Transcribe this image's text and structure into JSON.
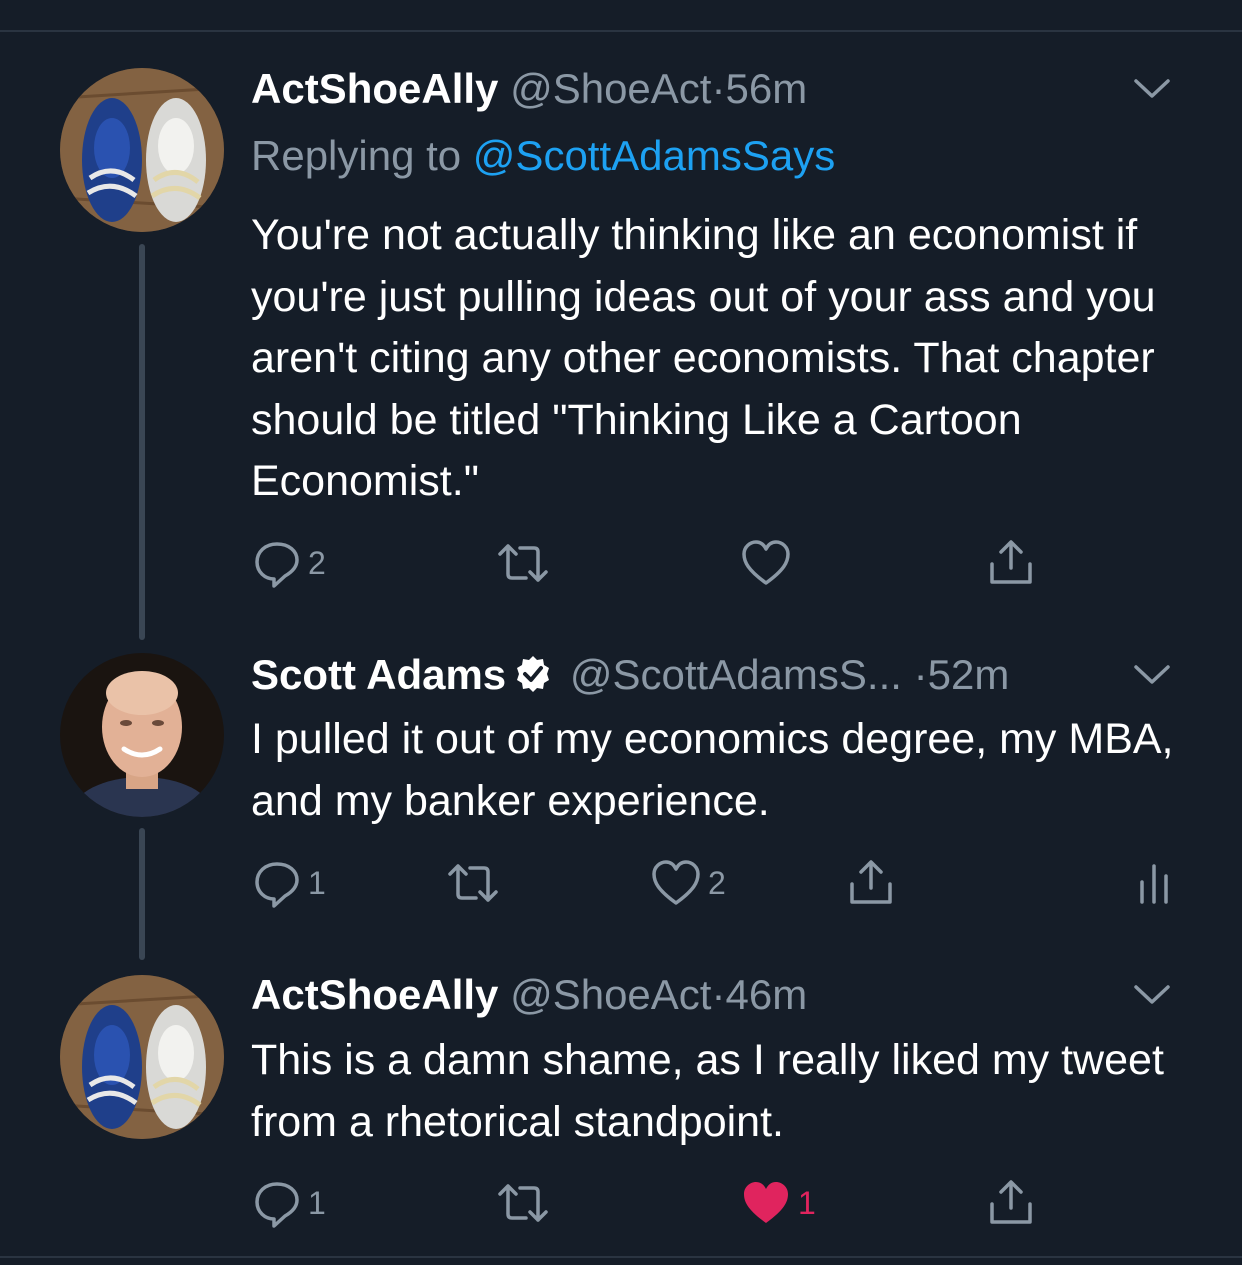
{
  "tweets": [
    {
      "name": "ActShoeAlly",
      "handle": "@ShoeAct",
      "dot": "·",
      "time": "56m",
      "reply_prefix": "Replying to ",
      "reply_mention": "@ScottAdamsSays",
      "text": "You're not actually thinking like an economist if you're just pulling ideas out of your ass and you aren't citing any other economists. That chapter should be titled \"Thinking Like a Cartoon Economist.\"",
      "reply_count": "2",
      "retweet_count": "",
      "like_count": "",
      "icons": [
        "reply-icon",
        "retweet-icon",
        "like-icon",
        "share-icon"
      ]
    },
    {
      "name": "Scott Adams",
      "handle": "@ScottAdamsS...",
      "dot": "·",
      "time": "52m",
      "text": "I pulled it out of my economics degree, my MBA, and my banker experience.",
      "reply_count": "1",
      "retweet_count": "",
      "like_count": "2",
      "icons": [
        "reply-icon",
        "retweet-icon",
        "like-icon",
        "share-icon",
        "analytics-icon"
      ]
    },
    {
      "name": "ActShoeAlly",
      "handle": "@ShoeAct",
      "dot": "·",
      "time": "46m",
      "text": "This is a damn shame, as I really liked my tweet from a rhetorical standpoint.",
      "reply_count": "1",
      "retweet_count": "",
      "like_count": "1",
      "liked": true,
      "icons": [
        "reply-icon",
        "retweet-icon",
        "liked-heart-icon",
        "share-icon"
      ]
    }
  ],
  "colors": {
    "background": "#151d28",
    "text_primary": "#ffffff",
    "text_secondary": "#8b98a5",
    "link": "#1da1f2",
    "like_active": "#e0245e",
    "verified": "#ffffff"
  }
}
